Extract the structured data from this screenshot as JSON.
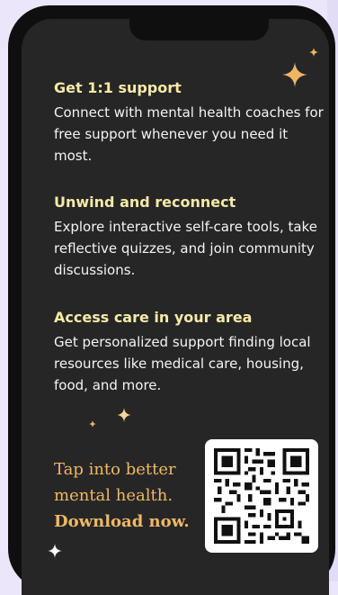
{
  "sections": [
    {
      "title": "Get 1:1 support",
      "body": "Connect with mental health coaches for free support whenever you need it most."
    },
    {
      "title": "Unwind and reconnect",
      "body": "Explore interactive self-care tools, take reflective quizzes, and join community discussions."
    },
    {
      "title": "Access care in your area",
      "body": "Get personalized support finding local resources like medical care, housing, food, and more."
    }
  ],
  "tagline": {
    "line1": "Tap into better",
    "line2": "mental health.",
    "line3": "Download now."
  },
  "qr": {
    "icon": "qr-code-icon"
  },
  "colors": {
    "background": "#ece6fb",
    "phone_frame": "#0f0f10",
    "screen": "#262626",
    "heading": "#f6eaa7",
    "body_text": "#f4f4f4",
    "tagline": "#f0b865",
    "sparkle": "#f2b463"
  }
}
